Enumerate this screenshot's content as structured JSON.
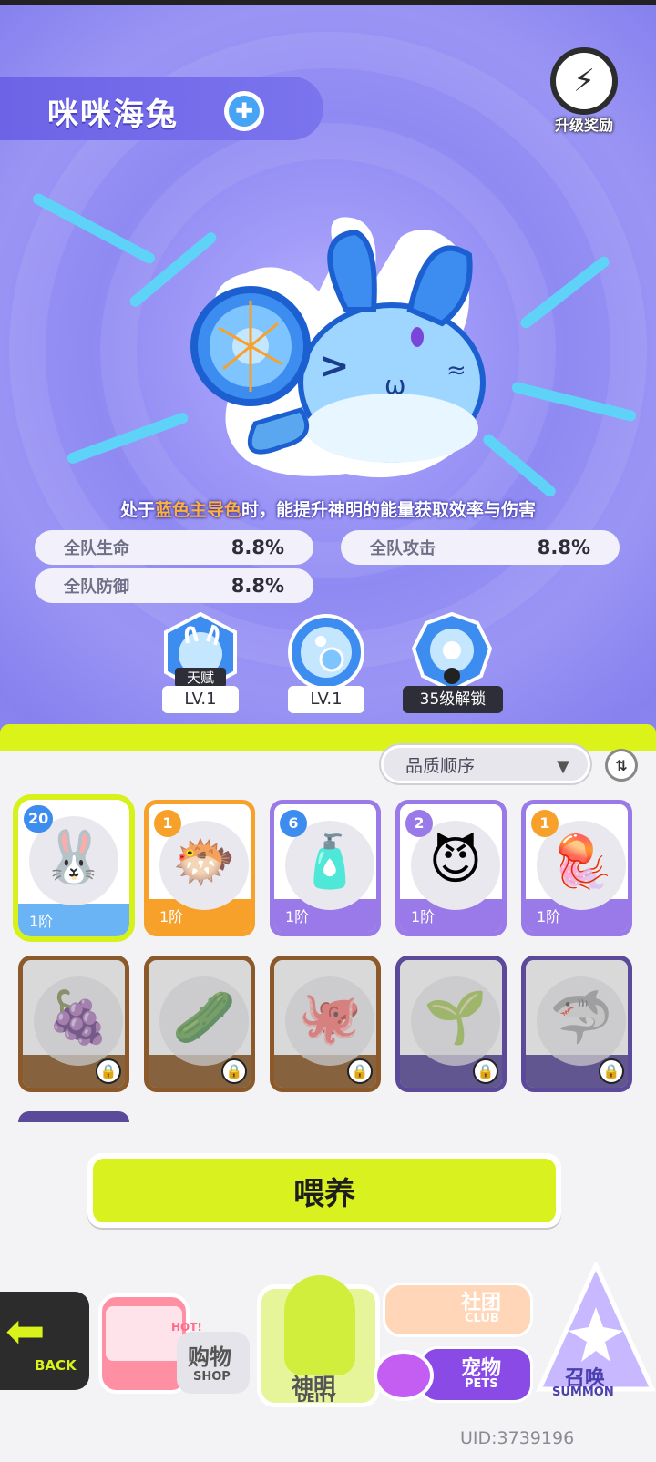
{
  "header": {
    "pet_name": "咪咪海兔",
    "element_icon": "plus-element-icon",
    "reward_label": "升级奖励"
  },
  "description": {
    "prefix": "处于",
    "highlight": "蓝色主导色",
    "suffix": "时，能提升神明的能量获取效率与伤害"
  },
  "stats": [
    {
      "label": "全队生命",
      "value": "8.8%"
    },
    {
      "label": "全队攻击",
      "value": "8.8%"
    },
    {
      "label": "全队防御",
      "value": "8.8%"
    }
  ],
  "skills": [
    {
      "tag": "天赋",
      "level": "LV.1",
      "icon": "rabbit-talent-icon"
    },
    {
      "level": "LV.1",
      "icon": "bubble-skill-icon"
    },
    {
      "level": "35级解锁",
      "icon": "flower-locked-skill-icon"
    }
  ],
  "sort": {
    "selected": "品质顺序",
    "toggle_icon": "swap-order-icon"
  },
  "pets": [
    {
      "count": "20",
      "tier": "1阶",
      "icon": "🐰",
      "rarity": "blue",
      "selected": true
    },
    {
      "count": "1",
      "tier": "1阶",
      "icon": "🐡",
      "rarity": "orange"
    },
    {
      "count": "6",
      "tier": "1阶",
      "icon": "🧴",
      "rarity": "purple"
    },
    {
      "count": "2",
      "tier": "1阶",
      "icon": "😈",
      "rarity": "purple"
    },
    {
      "count": "1",
      "tier": "1阶",
      "icon": "🪼",
      "rarity": "purple"
    },
    {
      "icon": "🍇",
      "rarity": "brown",
      "locked": true
    },
    {
      "icon": "🥒",
      "rarity": "brown",
      "locked": true
    },
    {
      "icon": "🐙",
      "rarity": "brown",
      "locked": true
    },
    {
      "icon": "🌱",
      "rarity": "indigo",
      "locked": true
    },
    {
      "icon": "🦈",
      "rarity": "indigo",
      "locked": true
    }
  ],
  "feed_button": "喂养",
  "nav": {
    "back": "BACK",
    "shop_cn": "购物",
    "shop_en": "SHOP",
    "shop_hot": "HOT!",
    "deity_cn": "神明",
    "deity_en": "DEITY",
    "club_cn": "社团",
    "club_en": "CLUB",
    "pets_cn": "宠物",
    "pets_en": "PETS",
    "summon_cn": "召唤",
    "summon_en": "SUMMON"
  },
  "uid": "UID:3739196",
  "colors": {
    "accent_lime": "#d9f21f",
    "hero_purple": "#8f8af2",
    "highlight_orange": "#ffb23a",
    "rarity_orange": "#f7a12a",
    "rarity_purple": "#9a79e8",
    "rarity_brown": "#8c5a2a",
    "rarity_indigo": "#5b4a9a"
  }
}
